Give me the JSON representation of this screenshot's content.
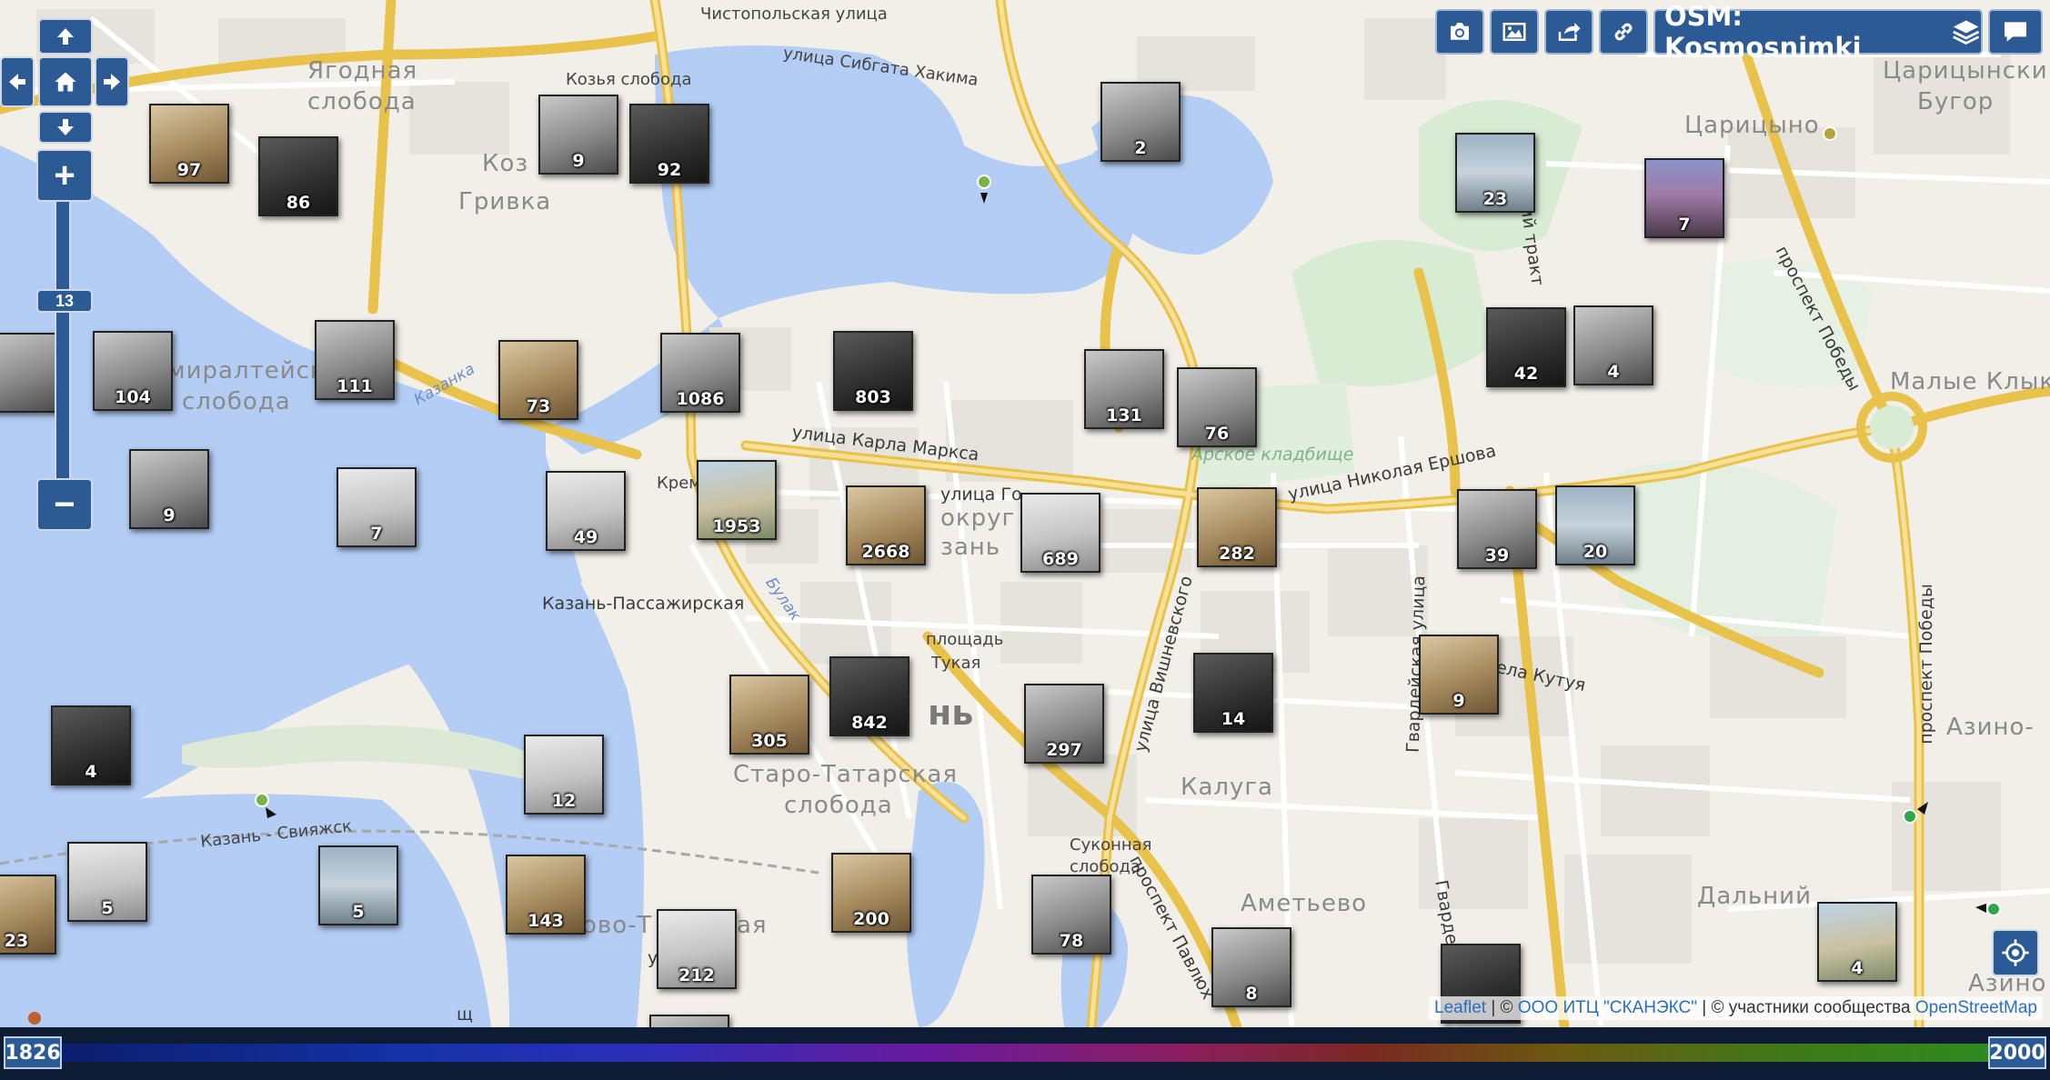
{
  "map": {
    "labels": {
      "chistopolskaya": "Чистопольская улица",
      "kozya_sloboda": "Козья слобода",
      "sibgata_hakima": "улица Сибгата Хакима",
      "yagodnaya_1": "Ягодная",
      "yagodnaya_2": "слобода",
      "koz_1": "Коз",
      "koz_2": "Гривка",
      "admiralteyskaya_1": "миралтейск",
      "admiralteyskaya_2": "слобода",
      "kazanka": "Казанка",
      "kreml": "Кремль",
      "karla_marksa": "улица Карла Маркса",
      "ulitsa_go": "улица Го",
      "okrug": "округ",
      "kazan_vakhit": "зань",
      "arskoe": "Арское кладбище",
      "ershova": "улица Николая Ершова",
      "passazhirskaya": "Казань-Пассажирская",
      "bulak": "Булак",
      "ploshchad_1": "площадь",
      "ploshchad_2": "Тукая",
      "kazan_big": "нь",
      "staro_1": "Старо-Татарская",
      "staro_2": "слобода",
      "vishnevskogo": "улица Вишневского",
      "kaluga": "Калуга",
      "gvardeyskaya": "Гвардейская улица",
      "kutuzova": "ела Кутуя",
      "sukonnaya_1": "Суконная",
      "sukonnaya_2": "слобода",
      "pavlyukhina": "проспект Павлюх",
      "ametyevo": "Аметьево",
      "gvardeyskaya2": "Гвардейск",
      "svyazhsk": "Казань - Свияжск",
      "novo": "ово-Т",
      "aya": "ая",
      "tsaritsyn_1": "Царицынский",
      "tsaritsyn_2": "Бугор",
      "tsaritsyno": "Царицыно",
      "pobedy_1": "проспект Победы",
      "pobedy_2": "проспект Победы",
      "malye_kliki": "Малые Клыки",
      "azino": "Азино-",
      "azino2": "Азино",
      "dalniy": "Дальний",
      "trakt": "ий тракт",
      "u1": "ул",
      "u2": "щ"
    },
    "clusters": [
      {
        "count": "97",
        "tone": "sepia"
      },
      {
        "count": "86",
        "tone": "dark"
      },
      {
        "count": "9",
        "tone": "gray"
      },
      {
        "count": "92",
        "tone": "dark"
      },
      {
        "count": "2",
        "tone": "gray"
      },
      {
        "count": "23",
        "tone": "sky"
      },
      {
        "count": "7",
        "tone": "color"
      },
      {
        "count": "104",
        "tone": "gray"
      },
      {
        "count": "111",
        "tone": "gray"
      },
      {
        "count": "73",
        "tone": "sepia"
      },
      {
        "count": "1086",
        "tone": "gray"
      },
      {
        "count": "803",
        "tone": "dark"
      },
      {
        "count": "131",
        "tone": "gray"
      },
      {
        "count": "76",
        "tone": "gray"
      },
      {
        "count": "42",
        "tone": "dark"
      },
      {
        "count": "4",
        "tone": "gray"
      },
      {
        "count": "9",
        "tone": "gray"
      },
      {
        "count": "7",
        "tone": "light"
      },
      {
        "count": "49",
        "tone": "light"
      },
      {
        "count": "1953",
        "tone": "colorlight"
      },
      {
        "count": "2668",
        "tone": "sepia"
      },
      {
        "count": "689",
        "tone": "light"
      },
      {
        "count": "282",
        "tone": "sepia"
      },
      {
        "count": "39",
        "tone": "gray"
      },
      {
        "count": "20",
        "tone": "sky"
      },
      {
        "count": "305",
        "tone": "sepia"
      },
      {
        "count": "842",
        "tone": "dark"
      },
      {
        "count": "297",
        "tone": "gray"
      },
      {
        "count": "14",
        "tone": "dark"
      },
      {
        "count": "9",
        "tone": "sepia"
      },
      {
        "count": "4",
        "tone": "dark"
      },
      {
        "count": "12",
        "tone": "light"
      },
      {
        "count": "5",
        "tone": "light"
      },
      {
        "count": "5",
        "tone": "sky"
      },
      {
        "count": "143",
        "tone": "sepia"
      },
      {
        "count": "200",
        "tone": "sepia"
      },
      {
        "count": "78",
        "tone": "gray"
      },
      {
        "count": "212",
        "tone": "light"
      },
      {
        "count": "8",
        "tone": "gray"
      },
      {
        "count": "23",
        "tone": "sepia"
      },
      {
        "count": "4",
        "tone": "colorlight"
      },
      {
        "count": "",
        "tone": "dark"
      },
      {
        "count": "",
        "tone": "gray"
      },
      {
        "count": "",
        "tone": "gray"
      }
    ]
  },
  "controls": {
    "zoom_in": "+",
    "zoom_out": "−",
    "zoom_level": "13"
  },
  "toolbar": {
    "layer_label": "OSM: Kosmosnimki"
  },
  "attribution": {
    "leaflet": "Leaflet",
    "sep1": " | © ",
    "scanex": "ООО ИТЦ \"СКАНЭКС\"",
    "sep2": " | © участники сообщества ",
    "osm": "OpenStreetMap"
  },
  "timeline": {
    "start_year": "1826",
    "end_year": "2000"
  },
  "colors": {
    "water": "#b3cdf5",
    "land": "#f2efe9",
    "road_major": "#f7d86a",
    "control_blue": "#2c5a95",
    "timeline_bg": "#0e1b35"
  }
}
